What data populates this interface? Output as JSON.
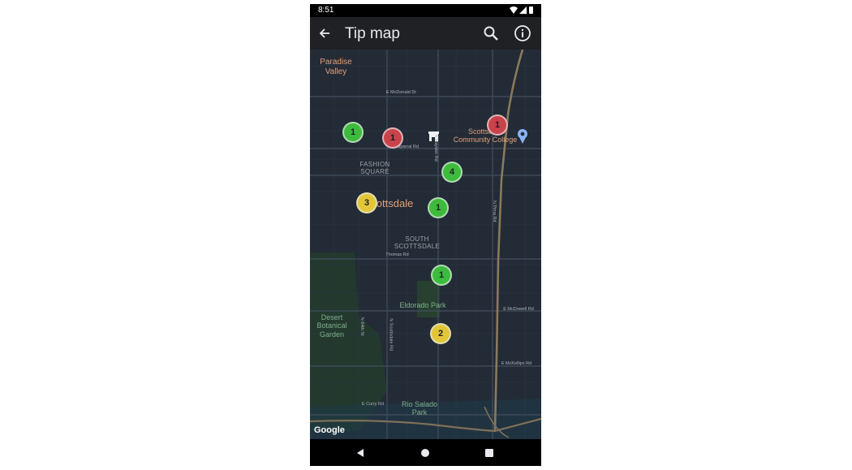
{
  "status_bar": {
    "time": "8:51"
  },
  "app_bar": {
    "title": "Tip map"
  },
  "map": {
    "labels": {
      "paradise_valley": "Paradise\nValley",
      "fashion_square": "FASHION\nSQUARE",
      "scottsdale": "Scottsdale",
      "south_scottsdale": "SOUTH\nSCOTTSDALE",
      "college": "Scottsdale\nCommunity College",
      "eldorado": "Eldorado Park",
      "desert_garden": "Desert\nBotanical\nGarden",
      "rio_salado": "Rio Salado\nPark",
      "mcdonald_dr": "E McDonald Dr",
      "chaparral_rd": "E Chaparral Rd",
      "thomas_rd": "Thomas Rd",
      "e_mcdowell": "E McDowell Rd",
      "mckellips": "E McKellips Rd",
      "curry": "E Curry Rd",
      "hayden": "N Hayden Rd",
      "pima": "N Pima Rd",
      "scottsdale_rd": "N Scottsdale Rd",
      "n64": "N 64th St"
    },
    "clusters": [
      {
        "id": "c1",
        "count": "1",
        "color": "green"
      },
      {
        "id": "c2",
        "count": "1",
        "color": "red"
      },
      {
        "id": "c3",
        "count": "1",
        "color": "red"
      },
      {
        "id": "c4",
        "count": "4",
        "color": "green"
      },
      {
        "id": "c5",
        "count": "3",
        "color": "yellow"
      },
      {
        "id": "c6",
        "count": "1",
        "color": "green"
      },
      {
        "id": "c7",
        "count": "1",
        "color": "green"
      },
      {
        "id": "c8",
        "count": "2",
        "color": "yellow"
      }
    ],
    "attribution": "Google"
  },
  "icons": {
    "back": "arrow-back-icon",
    "search": "search-icon",
    "info": "info-icon",
    "wifi": "wifi-icon",
    "signal": "signal-icon",
    "battery": "battery-icon",
    "store": "store-icon",
    "pin": "place-pin-icon",
    "nav_back": "nav-back-icon",
    "nav_home": "nav-home-icon",
    "nav_recents": "nav-recents-icon"
  }
}
